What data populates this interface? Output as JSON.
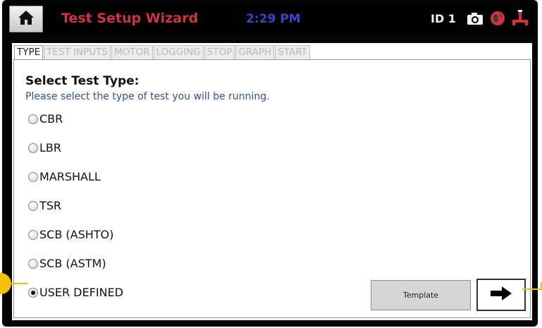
{
  "header": {
    "title": "Test Setup Wizard",
    "time": "2:29 PM",
    "device_id": "ID 1",
    "home_icon": "home-icon",
    "status_icons": [
      "camera-icon",
      "globe-icon",
      "network-icon"
    ]
  },
  "tabs": [
    {
      "label": "TYPE",
      "active": true
    },
    {
      "label": "TEST INPUTS",
      "active": false
    },
    {
      "label": "MOTOR",
      "active": false
    },
    {
      "label": "LOGGING",
      "active": false
    },
    {
      "label": "STOP",
      "active": false
    },
    {
      "label": "GRAPH",
      "active": false
    },
    {
      "label": "START",
      "active": false
    }
  ],
  "content": {
    "heading": "Select Test Type:",
    "instructions": "Please select the type of test you will be running.",
    "options": [
      {
        "label": "CBR",
        "checked": false
      },
      {
        "label": "LBR",
        "checked": false
      },
      {
        "label": "MARSHALL",
        "checked": false
      },
      {
        "label": "TSR",
        "checked": false
      },
      {
        "label": "SCB (ASHTO)",
        "checked": false
      },
      {
        "label": "SCB (ASTM)",
        "checked": false
      },
      {
        "label": "USER DEFINED",
        "checked": true
      }
    ]
  },
  "buttons": {
    "template_label": "Template",
    "next_icon": "arrow-right-icon"
  },
  "colors": {
    "title": "#d1343a",
    "clock": "#3447c9",
    "instructions": "#2f4fa0",
    "callout": "#f2c200"
  }
}
